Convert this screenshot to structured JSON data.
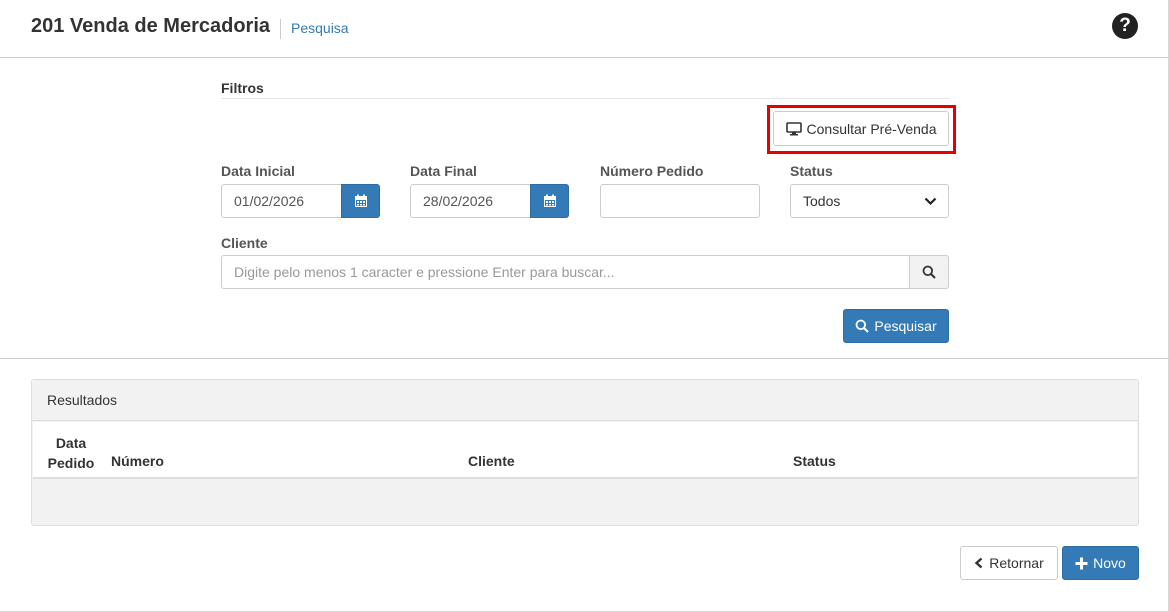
{
  "header": {
    "title": "201 Venda de Mercadoria",
    "breadcrumb": "Pesquisa",
    "help_icon": "question-circle-icon",
    "help_glyph": "?"
  },
  "filters": {
    "section_title": "Filtros",
    "consultar_button": "Consultar Pré-Venda",
    "data_inicial": {
      "label": "Data Inicial",
      "value": "01/02/2026"
    },
    "data_final": {
      "label": "Data Final",
      "value": "28/02/2026"
    },
    "numero_pedido": {
      "label": "Número Pedido",
      "value": ""
    },
    "status": {
      "label": "Status",
      "value": "Todos"
    },
    "cliente": {
      "label": "Cliente",
      "placeholder": "Digite pelo menos 1 caracter e pressione Enter para buscar..."
    },
    "pesquisar_button": "Pesquisar"
  },
  "results": {
    "title": "Resultados",
    "columns": {
      "data_line1": "Data",
      "data_line2": "Pedido",
      "numero": "Número",
      "cliente": "Cliente",
      "status": "Status"
    },
    "rows": []
  },
  "footer": {
    "retornar_button": "Retornar",
    "novo_button": "Novo"
  },
  "colors": {
    "primary": "#337ab7",
    "highlight": "#e60000",
    "link": "#337ab7"
  }
}
